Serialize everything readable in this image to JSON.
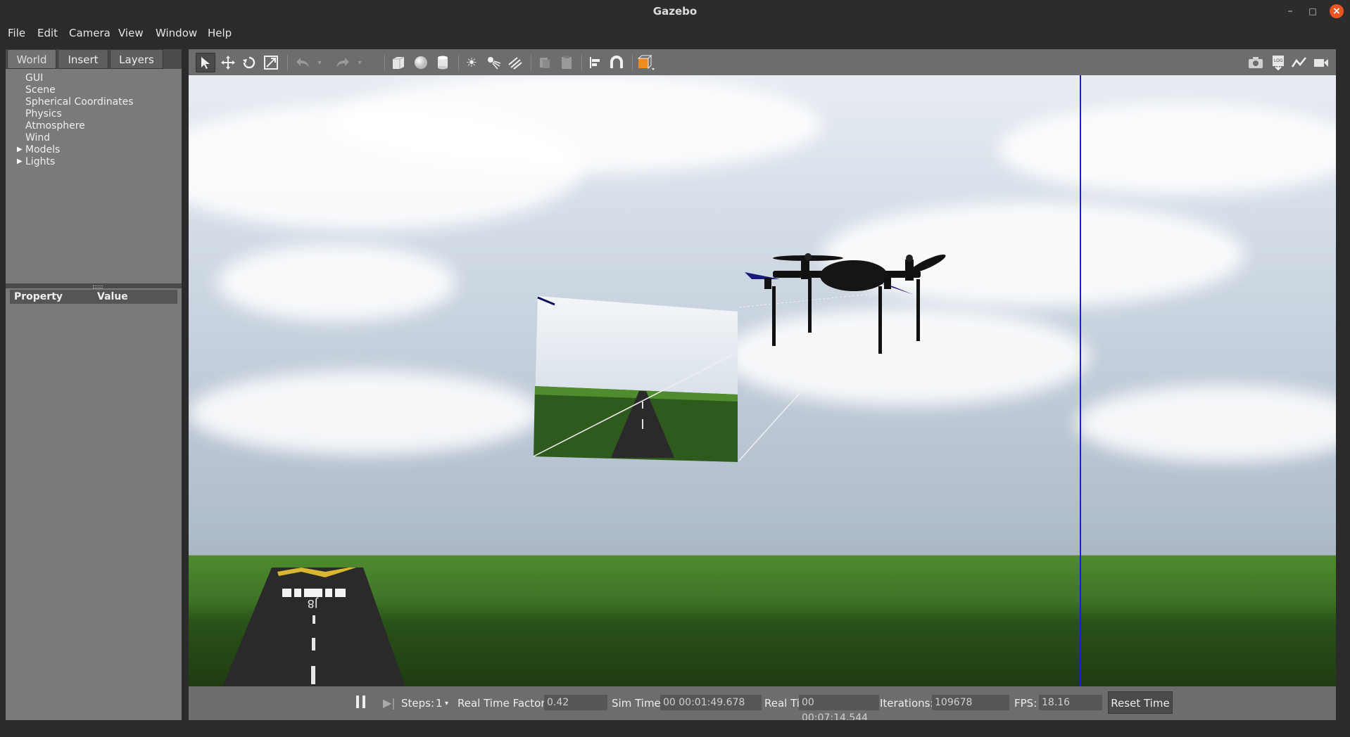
{
  "window": {
    "title": "Gazebo"
  },
  "menu": [
    "File",
    "Edit",
    "Camera",
    "View",
    "Window",
    "Help"
  ],
  "left_panel": {
    "tabs": [
      "World",
      "Insert",
      "Layers"
    ],
    "active_tab": "World",
    "tree": [
      "GUI",
      "Scene",
      "Spherical Coordinates",
      "Physics",
      "Atmosphere",
      "Wind",
      "Models",
      "Lights"
    ],
    "property_header": {
      "property": "Property",
      "value": "Value"
    }
  },
  "toolbar": {
    "tools": [
      "select-mode-icon",
      "translate-mode-icon",
      "rotate-mode-icon",
      "scale-mode-icon",
      "undo-icon",
      "redo-icon",
      "box-icon",
      "sphere-icon",
      "cylinder-icon",
      "point-light-icon",
      "spot-light-icon",
      "directional-light-icon",
      "copy-icon",
      "paste-icon",
      "align-icon",
      "snap-icon",
      "view-angle-icon",
      "screenshot-icon",
      "log-icon",
      "plot-icon",
      "video-record-icon"
    ]
  },
  "viewport": {
    "runway_marking": "J8"
  },
  "status": {
    "steps_label": "Steps:",
    "steps_value": "1",
    "rtf_label": "Real Time Factor:",
    "rtf_value": "0.42",
    "sim_time_label": "Sim Time:",
    "sim_time_value": "00 00:01:49.678",
    "real_time_label": "Real Time:",
    "real_time_value": "00 00:07:14.544",
    "iterations_label": "Iterations:",
    "iterations_value": "109678",
    "fps_label": "FPS:",
    "fps_value": "18.16",
    "reset_label": "Reset Time"
  }
}
